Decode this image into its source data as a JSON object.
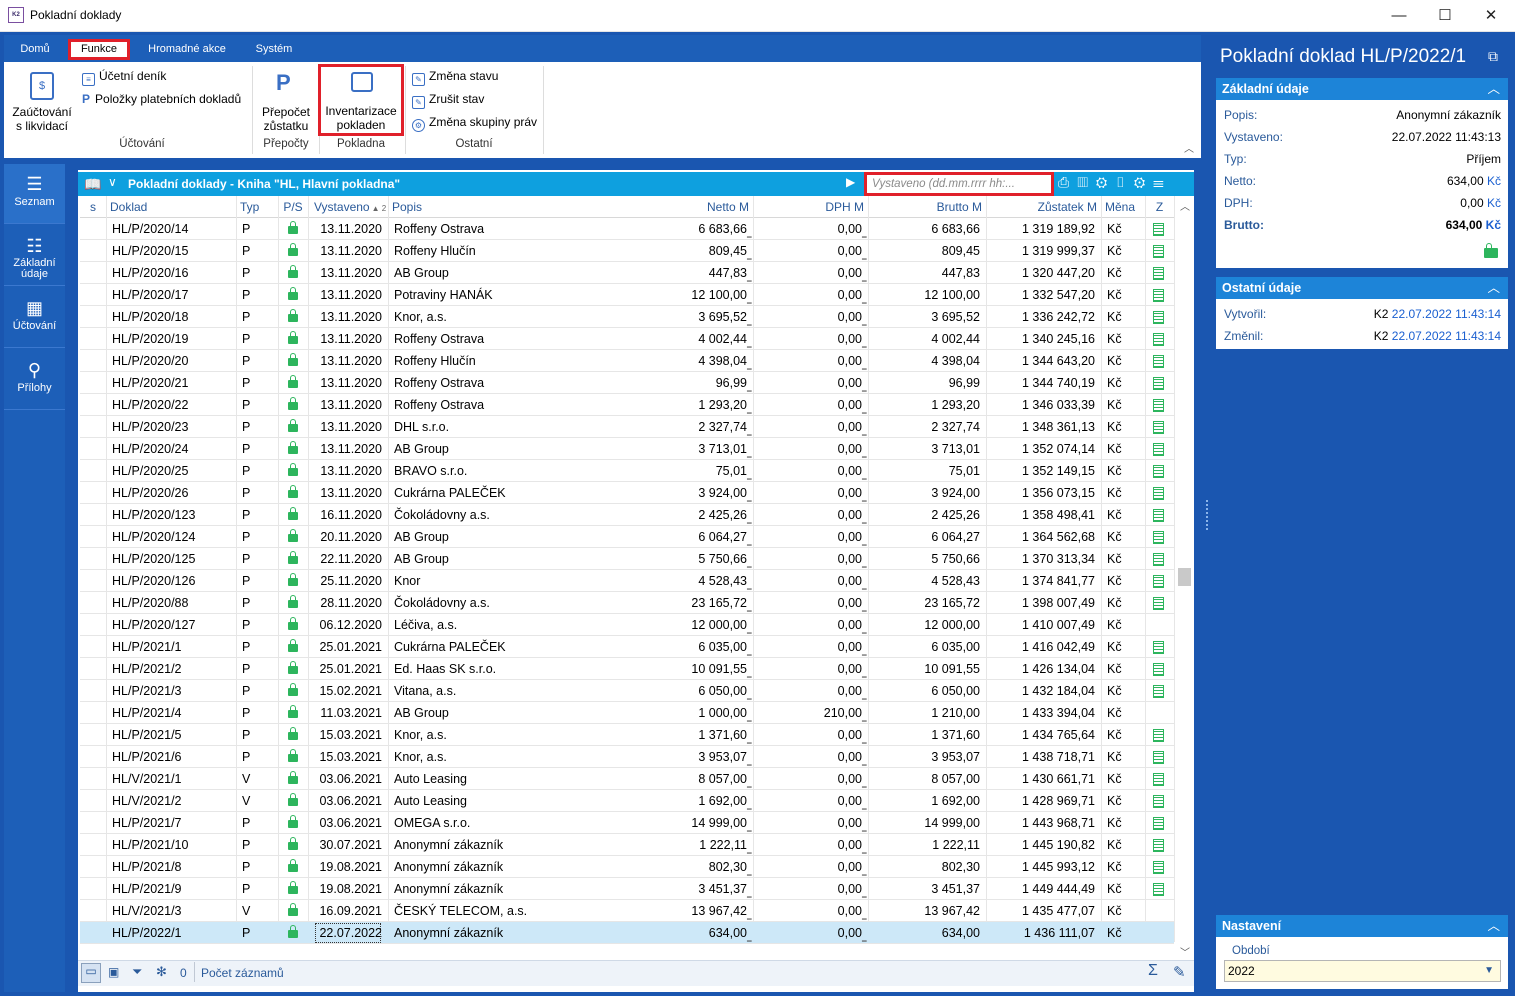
{
  "window": {
    "title": "Pokladní doklady",
    "logo": "K2"
  },
  "ribbon": {
    "tabs": [
      "Domů",
      "Funkce",
      "Hromadné akce",
      "Systém"
    ],
    "buttons": {
      "zauctovani": "Zaúčtování s likvidací",
      "ucetni_denik": "Účetní deník",
      "polozky": "Položky platebních dokladů",
      "prepocet": "Přepočet zůstatku",
      "inventarizace": "Inventarizace pokladen",
      "zmena_stavu": "Změna stavu",
      "zrusit_stav": "Zrušit stav",
      "zmena_skupiny": "Změna skupiny práv"
    },
    "groups": [
      "Účtování",
      "Přepočty",
      "Pokladna",
      "Ostatní"
    ]
  },
  "leftnav": [
    "Seznam",
    "Základní údaje",
    "Účtování",
    "Přílohy"
  ],
  "grid": {
    "title": "Pokladní doklady - Kniha \"HL, Hlavní pokladna\"",
    "search_placeholder": "Vystaveno (dd.mm.rrrr hh:...",
    "columns": [
      "s",
      "Doklad",
      "Typ",
      "P/S",
      "Vystaveno",
      "Popis",
      "Netto M",
      "DPH M",
      "Brutto M",
      "Zůstatek M",
      "Měna",
      "Z"
    ],
    "sort_indicator": "▲ 2",
    "rows": [
      [
        "HL/P/2020/14",
        "P",
        "13.11.2020",
        "Roffeny Ostrava",
        "6 683,66",
        "0,00",
        "6 683,66",
        "1 319 189,92",
        "Kč",
        true
      ],
      [
        "HL/P/2020/15",
        "P",
        "13.11.2020",
        "Roffeny Hlučín",
        "809,45",
        "0,00",
        "809,45",
        "1 319 999,37",
        "Kč",
        true
      ],
      [
        "HL/P/2020/16",
        "P",
        "13.11.2020",
        "AB Group",
        "447,83",
        "0,00",
        "447,83",
        "1 320 447,20",
        "Kč",
        true
      ],
      [
        "HL/P/2020/17",
        "P",
        "13.11.2020",
        "Potraviny HANÁK",
        "12 100,00",
        "0,00",
        "12 100,00",
        "1 332 547,20",
        "Kč",
        true
      ],
      [
        "HL/P/2020/18",
        "P",
        "13.11.2020",
        "Knor, a.s.",
        "3 695,52",
        "0,00",
        "3 695,52",
        "1 336 242,72",
        "Kč",
        true
      ],
      [
        "HL/P/2020/19",
        "P",
        "13.11.2020",
        "Roffeny Ostrava",
        "4 002,44",
        "0,00",
        "4 002,44",
        "1 340 245,16",
        "Kč",
        true
      ],
      [
        "HL/P/2020/20",
        "P",
        "13.11.2020",
        "Roffeny Hlučín",
        "4 398,04",
        "0,00",
        "4 398,04",
        "1 344 643,20",
        "Kč",
        true
      ],
      [
        "HL/P/2020/21",
        "P",
        "13.11.2020",
        "Roffeny Ostrava",
        "96,99",
        "0,00",
        "96,99",
        "1 344 740,19",
        "Kč",
        true
      ],
      [
        "HL/P/2020/22",
        "P",
        "13.11.2020",
        "Roffeny Ostrava",
        "1 293,20",
        "0,00",
        "1 293,20",
        "1 346 033,39",
        "Kč",
        true
      ],
      [
        "HL/P/2020/23",
        "P",
        "13.11.2020",
        "DHL s.r.o.",
        "2 327,74",
        "0,00",
        "2 327,74",
        "1 348 361,13",
        "Kč",
        true
      ],
      [
        "HL/P/2020/24",
        "P",
        "13.11.2020",
        "AB Group",
        "3 713,01",
        "0,00",
        "3 713,01",
        "1 352 074,14",
        "Kč",
        true
      ],
      [
        "HL/P/2020/25",
        "P",
        "13.11.2020",
        "BRAVO s.r.o.",
        "75,01",
        "0,00",
        "75,01",
        "1 352 149,15",
        "Kč",
        true
      ],
      [
        "HL/P/2020/26",
        "P",
        "13.11.2020",
        "Cukrárna PALEČEK",
        "3 924,00",
        "0,00",
        "3 924,00",
        "1 356 073,15",
        "Kč",
        true
      ],
      [
        "HL/P/2020/123",
        "P",
        "16.11.2020",
        "Čokoládovny a.s.",
        "2 425,26",
        "0,00",
        "2 425,26",
        "1 358 498,41",
        "Kč",
        true
      ],
      [
        "HL/P/2020/124",
        "P",
        "20.11.2020",
        "AB Group",
        "6 064,27",
        "0,00",
        "6 064,27",
        "1 364 562,68",
        "Kč",
        true
      ],
      [
        "HL/P/2020/125",
        "P",
        "22.11.2020",
        "AB Group",
        "5 750,66",
        "0,00",
        "5 750,66",
        "1 370 313,34",
        "Kč",
        true
      ],
      [
        "HL/P/2020/126",
        "P",
        "25.11.2020",
        "Knor",
        "4 528,43",
        "0,00",
        "4 528,43",
        "1 374 841,77",
        "Kč",
        true
      ],
      [
        "HL/P/2020/88",
        "P",
        "28.11.2020",
        "Čokoládovny a.s.",
        "23 165,72",
        "0,00",
        "23 165,72",
        "1 398 007,49",
        "Kč",
        true
      ],
      [
        "HL/P/2020/127",
        "P",
        "06.12.2020",
        "Léčiva, a.s.",
        "12 000,00",
        "0,00",
        "12 000,00",
        "1 410 007,49",
        "Kč",
        false
      ],
      [
        "HL/P/2021/1",
        "P",
        "25.01.2021",
        "Cukrárna PALEČEK",
        "6 035,00",
        "0,00",
        "6 035,00",
        "1 416 042,49",
        "Kč",
        true
      ],
      [
        "HL/P/2021/2",
        "P",
        "25.01.2021",
        "Ed. Haas SK s.r.o.",
        "10 091,55",
        "0,00",
        "10 091,55",
        "1 426 134,04",
        "Kč",
        true
      ],
      [
        "HL/P/2021/3",
        "P",
        "15.02.2021",
        "Vitana, a.s.",
        "6 050,00",
        "0,00",
        "6 050,00",
        "1 432 184,04",
        "Kč",
        true
      ],
      [
        "HL/P/2021/4",
        "P",
        "11.03.2021",
        "AB Group",
        "1 000,00",
        "210,00",
        "1 210,00",
        "1 433 394,04",
        "Kč",
        false
      ],
      [
        "HL/P/2021/5",
        "P",
        "15.03.2021",
        "Knor, a.s.",
        "1 371,60",
        "0,00",
        "1 371,60",
        "1 434 765,64",
        "Kč",
        true
      ],
      [
        "HL/P/2021/6",
        "P",
        "15.03.2021",
        "Knor, a.s.",
        "3 953,07",
        "0,00",
        "3 953,07",
        "1 438 718,71",
        "Kč",
        true
      ],
      [
        "HL/V/2021/1",
        "V",
        "03.06.2021",
        "Auto Leasing",
        "8 057,00",
        "0,00",
        "8 057,00",
        "1 430 661,71",
        "Kč",
        true
      ],
      [
        "HL/V/2021/2",
        "V",
        "03.06.2021",
        "Auto Leasing",
        "1 692,00",
        "0,00",
        "1 692,00",
        "1 428 969,71",
        "Kč",
        true
      ],
      [
        "HL/P/2021/7",
        "P",
        "03.06.2021",
        "OMEGA s.r.o.",
        "14 999,00",
        "0,00",
        "14 999,00",
        "1 443 968,71",
        "Kč",
        true
      ],
      [
        "HL/P/2021/10",
        "P",
        "30.07.2021",
        "Anonymní zákazník",
        "1 222,11",
        "0,00",
        "1 222,11",
        "1 445 190,82",
        "Kč",
        true
      ],
      [
        "HL/P/2021/8",
        "P",
        "19.08.2021",
        "Anonymní zákazník",
        "802,30",
        "0,00",
        "802,30",
        "1 445 993,12",
        "Kč",
        true
      ],
      [
        "HL/P/2021/9",
        "P",
        "19.08.2021",
        "Anonymní zákazník",
        "3 451,37",
        "0,00",
        "3 451,37",
        "1 449 444,49",
        "Kč",
        true
      ],
      [
        "HL/V/2021/3",
        "V",
        "16.09.2021",
        "ČESKÝ TELECOM, a.s.",
        "13 967,42",
        "0,00",
        "13 967,42",
        "1 435 477,07",
        "Kč",
        false
      ],
      [
        "HL/P/2022/1",
        "P",
        "22.07.2022",
        "Anonymní zákazník",
        "634,00",
        "0,00",
        "634,00",
        "1 436 111,07",
        "Kč",
        false
      ]
    ],
    "footer": {
      "count": "0",
      "label": "Počet záznamů"
    }
  },
  "detail": {
    "title": "Pokladní doklad HL/P/2022/1",
    "basic": {
      "header": "Základní údaje",
      "popis_l": "Popis:",
      "popis": "Anonymní zákazník",
      "vyst_l": "Vystaveno:",
      "vyst": "22.07.2022 11:43:13",
      "typ_l": "Typ:",
      "typ": "Příjem",
      "netto_l": "Netto:",
      "netto": "634,00",
      "dph_l": "DPH:",
      "dph": "0,00",
      "brutto_l": "Brutto:",
      "brutto": "634,00",
      "currency": "Kč"
    },
    "other": {
      "header": "Ostatní údaje",
      "created_l": "Vytvořil:",
      "created_user": "K2",
      "created": "22.07.2022 11:43:14",
      "changed_l": "Změnil:",
      "changed_user": "K2",
      "changed": "22.07.2022 11:43:14"
    },
    "settings": {
      "header": "Nastavení",
      "period_l": "Období",
      "period": "2022"
    }
  },
  "colors": {
    "frame": "#1a56b0",
    "grid_header": "#0ea0df",
    "highlight": "#e0202a",
    "lock": "#2db55d"
  }
}
